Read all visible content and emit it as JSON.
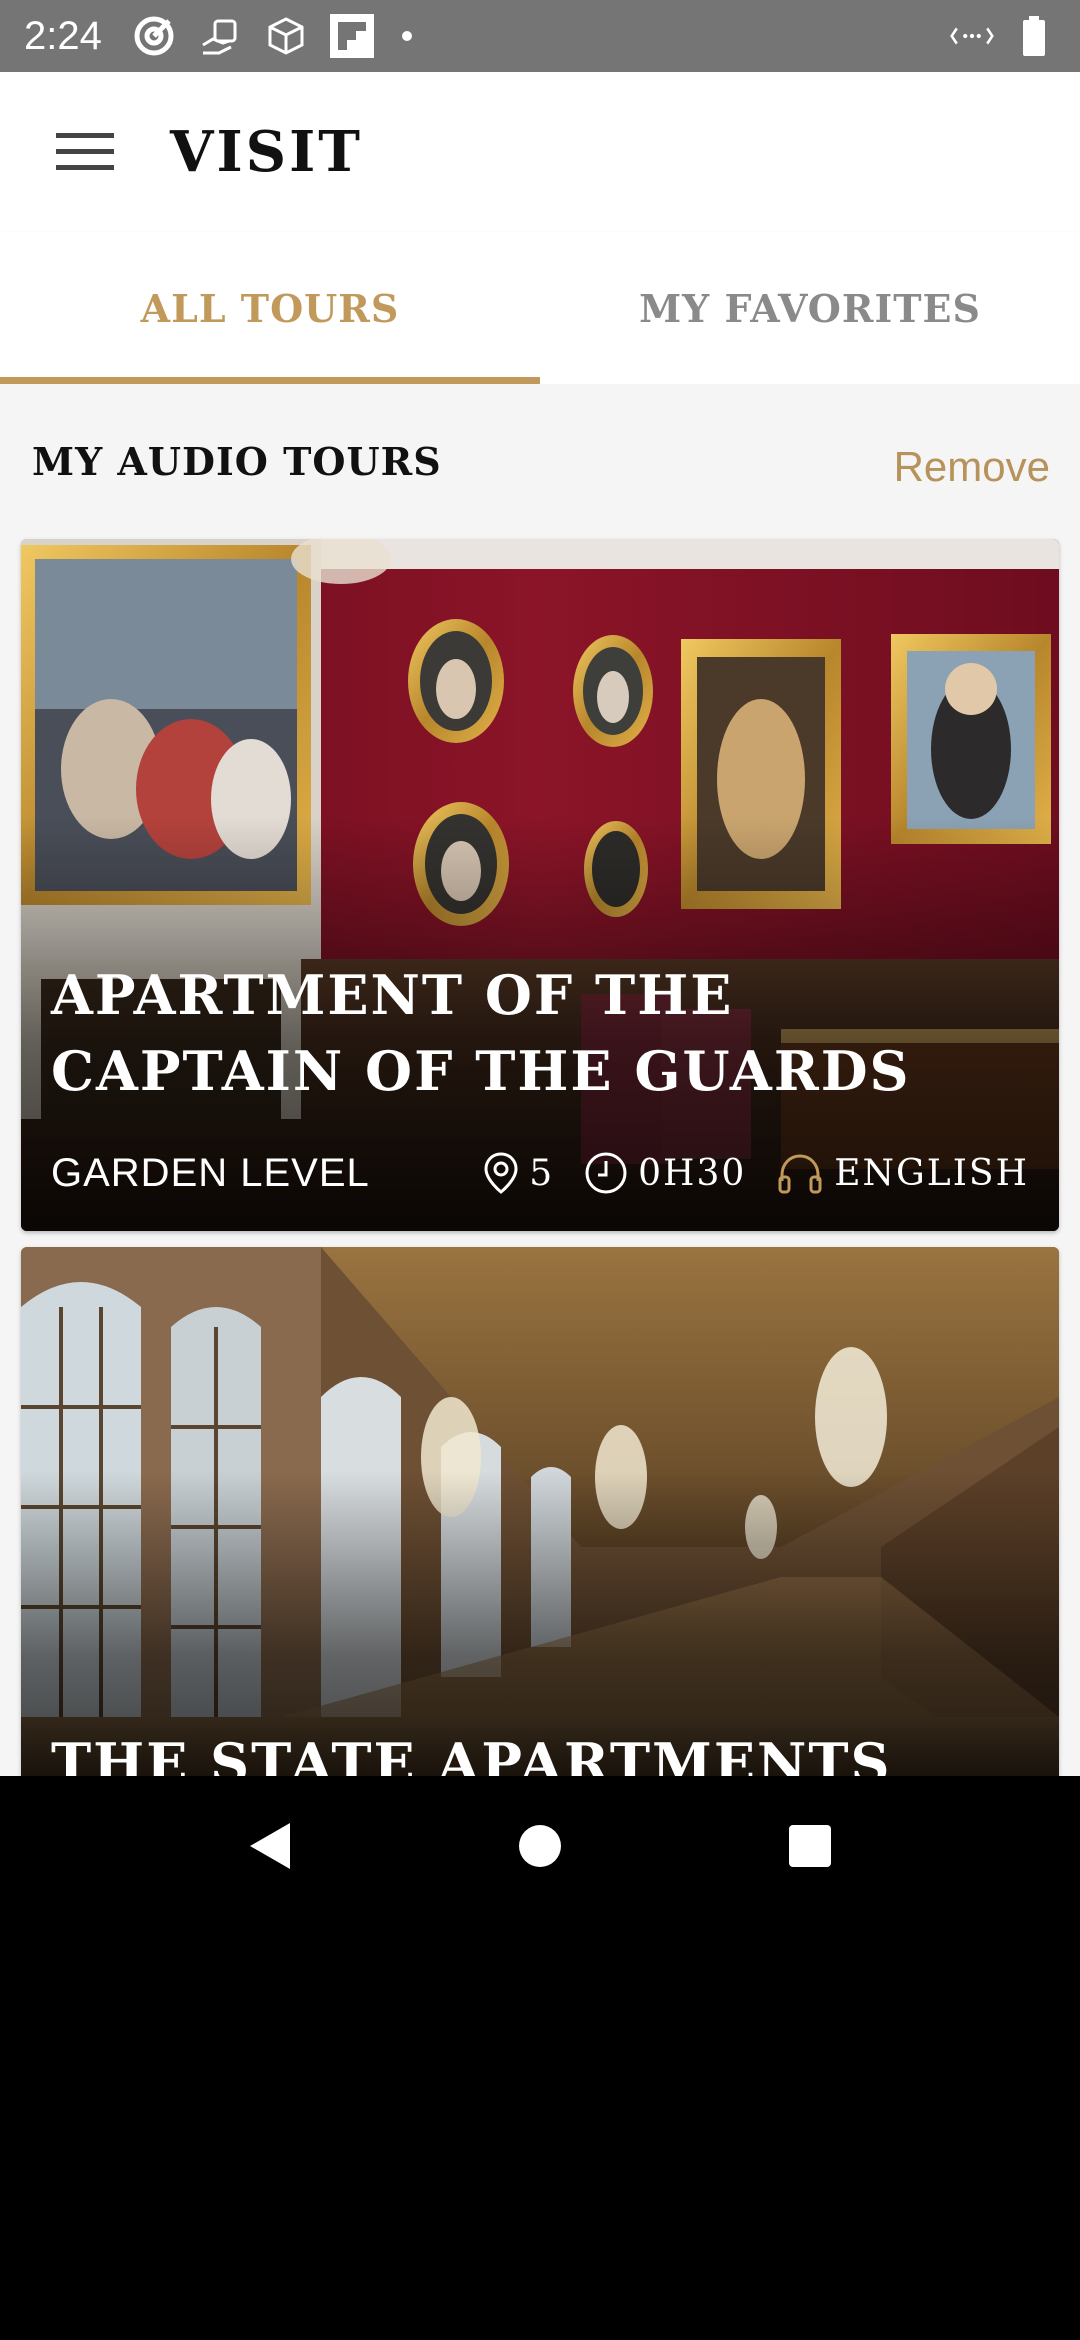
{
  "status_bar": {
    "time": "2:24",
    "icons": [
      "target-icon",
      "hand-payment-icon",
      "box-icon",
      "flipboard-icon",
      "dot-icon"
    ],
    "right_icons": [
      "data-saver-icon",
      "battery-icon"
    ]
  },
  "app_bar": {
    "title": "VISIT",
    "menu_icon": "hamburger-menu-icon"
  },
  "tabs": [
    {
      "label": "ALL TOURS",
      "active": true
    },
    {
      "label": "MY FAVORITES",
      "active": false
    }
  ],
  "section": {
    "title": "MY AUDIO TOURS",
    "action": "Remove"
  },
  "tours": [
    {
      "title": "APARTMENT OF THE CAPTAIN OF THE GUARDS",
      "level": "GARDEN LEVEL",
      "stops": "5",
      "duration": "0H30",
      "language": "ENGLISH"
    },
    {
      "title": "THE STATE APARTMENTS"
    }
  ],
  "colors": {
    "accent": "#C19A5B",
    "status_bar": "#757575",
    "wall_red": "#7a0f22"
  },
  "nav_bar": {
    "icons": [
      "back-icon",
      "home-icon",
      "recents-icon"
    ]
  }
}
